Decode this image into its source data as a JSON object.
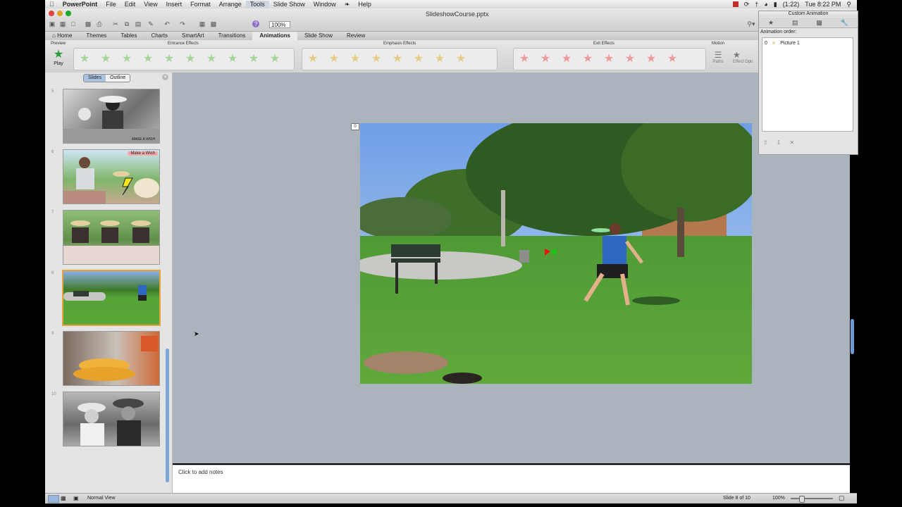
{
  "menubar": {
    "apple": "",
    "app_name": "PowerPoint",
    "items": [
      "File",
      "Edit",
      "View",
      "Insert",
      "Format",
      "Arrange",
      "Tools",
      "Slide Show",
      "Window",
      "Help"
    ],
    "active_item": "Tools",
    "battery": "(1:22)",
    "clock": "Tue 8:22 PM"
  },
  "window": {
    "title": "SlideshowCourse.pptx",
    "zoom": "100%"
  },
  "ribbon": {
    "tabs": [
      "Home",
      "Themes",
      "Tables",
      "Charts",
      "SmartArt",
      "Transitions",
      "Animations",
      "Slide Show",
      "Review"
    ],
    "active_tab": "Animations",
    "groups": {
      "preview": "Preview",
      "entrance": "Entrance Effects",
      "emphasis": "Emphasis Effects",
      "exit": "Exit Effects",
      "motion": "Motion"
    },
    "play_label": "Play",
    "paths_label": "Paths",
    "effect_options_label": "Effect Opti"
  },
  "navpane": {
    "segment_slides": "Slides",
    "segment_outline": "Outline",
    "thumb_caption_make_a_wish": "MAKE A WISH",
    "thumb_badge": "Make a Wish",
    "slide_numbers": [
      "5",
      "6",
      "7",
      "8",
      "9",
      "10"
    ]
  },
  "canvas": {
    "anim_tag": "0"
  },
  "notes": {
    "placeholder": "Click to add notes"
  },
  "status": {
    "view": "Normal View",
    "slide_info": "Slide 8 of 10",
    "zoom": "100%"
  },
  "anim_panel": {
    "title": "Custom Animation",
    "order_label": "Animation order:",
    "items": [
      {
        "index": "0",
        "name": "Picture 1"
      }
    ]
  }
}
